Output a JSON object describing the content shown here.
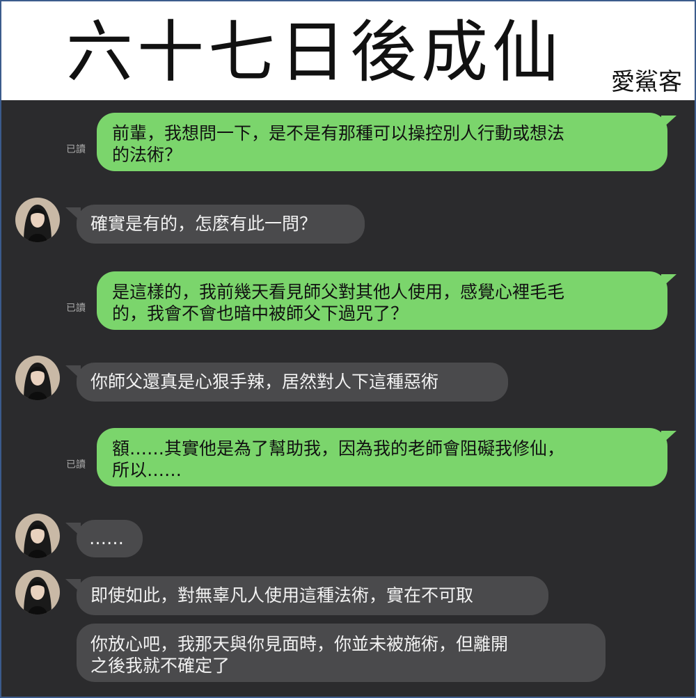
{
  "header": {
    "title": "六十七日後成仙",
    "author": "愛鯊客"
  },
  "colors": {
    "outgoing_bubble": "#7bd56c",
    "incoming_bubble": "#4a4a4c",
    "chat_background": "#2b2b2d",
    "frame_border": "#3b5b8c"
  },
  "icons": {
    "avatar": "character-avatar"
  },
  "messages": [
    {
      "side": "out",
      "read_label": "已讀",
      "lines": [
        "前輩，我想問一下，是不是有那種可以操控別人行動或想法",
        "的法術？"
      ]
    },
    {
      "side": "in",
      "lines": [
        "確實是有的，怎麼有此一問？"
      ]
    },
    {
      "side": "out",
      "read_label": "已讀",
      "lines": [
        "是這樣的，我前幾天看見師父對其他人使用，感覺心裡毛毛",
        "的，我會不會也暗中被師父下過咒了？"
      ]
    },
    {
      "side": "in",
      "lines": [
        "你師父還真是心狠手辣，居然對人下這種惡術"
      ]
    },
    {
      "side": "out",
      "read_label": "已讀",
      "lines": [
        "額……其實他是為了幫助我，因為我的老師會阻礙我修仙，",
        "所以……"
      ]
    },
    {
      "side": "in",
      "lines": [
        "……"
      ]
    },
    {
      "side": "in",
      "lines": [
        "即使如此，對無辜凡人使用這種法術，實在不可取"
      ]
    },
    {
      "side": "in",
      "lines": [
        "你放心吧，我那天與你見面時，你並未被施術，但離開",
        "之後我就不確定了"
      ]
    }
  ]
}
